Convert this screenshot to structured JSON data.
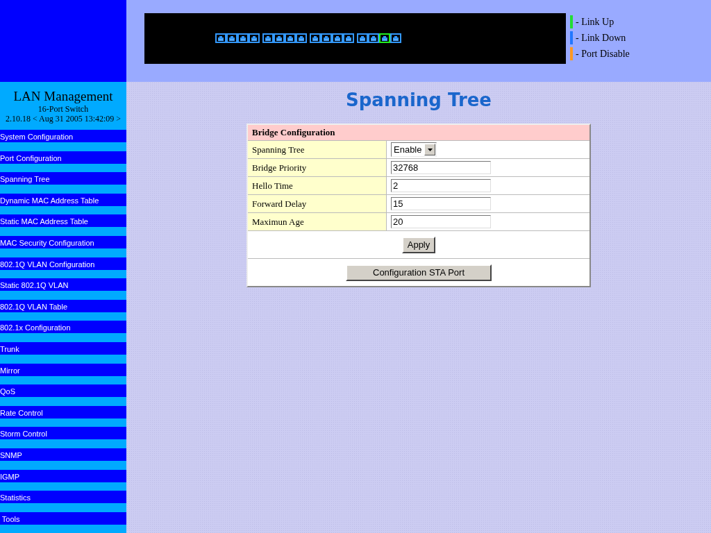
{
  "ports": [
    {
      "link_up": false
    },
    {
      "link_up": false
    },
    {
      "link_up": false
    },
    {
      "link_up": false
    },
    {
      "link_up": false
    },
    {
      "link_up": false
    },
    {
      "link_up": false
    },
    {
      "link_up": false
    },
    {
      "link_up": false
    },
    {
      "link_up": false
    },
    {
      "link_up": false
    },
    {
      "link_up": false
    },
    {
      "link_up": false
    },
    {
      "link_up": false
    },
    {
      "link_up": true
    },
    {
      "link_up": false
    }
  ],
  "legend": [
    {
      "label": "- Link Up",
      "color": "#22dd33"
    },
    {
      "label": "- Link Down",
      "color": "#2277ff"
    },
    {
      "label": "- Port Disable",
      "color": "#ff9922"
    }
  ],
  "brand": {
    "title": "LAN Management",
    "model": "16-Port Switch",
    "version": "2.10.18 < Aug 31 2005 13:42:09 >"
  },
  "sidebar": {
    "items": [
      {
        "label": "System Configuration"
      },
      {
        "label": "Port Configuration"
      },
      {
        "label": "Spanning Tree"
      },
      {
        "label": "Dynamic MAC Address Table"
      },
      {
        "label": "Static MAC Address Table"
      },
      {
        "label": "MAC Security Configuration"
      },
      {
        "label": "802.1Q VLAN Configuration"
      },
      {
        "label": "Static 802.1Q VLAN"
      },
      {
        "label": "802.1Q VLAN Table"
      },
      {
        "label": "802.1x Configuration"
      },
      {
        "label": "Trunk"
      },
      {
        "label": "Mirror"
      },
      {
        "label": "QoS"
      },
      {
        "label": "Rate Control"
      },
      {
        "label": "Storm Control"
      },
      {
        "label": "SNMP"
      },
      {
        "label": "IGMP"
      },
      {
        "label": "Statistics"
      },
      {
        "label": " Tools"
      }
    ]
  },
  "page_title": "Spanning Tree",
  "form": {
    "heading": "Bridge Configuration",
    "rows": [
      {
        "kind": "select",
        "label": "Spanning Tree",
        "value": "Enable"
      },
      {
        "kind": "text",
        "label": "Bridge Priority",
        "value": "32768"
      },
      {
        "kind": "text",
        "label": "Hello Time",
        "value": "2"
      },
      {
        "kind": "text",
        "label": "Forward Delay",
        "value": "15"
      },
      {
        "kind": "text",
        "label": "Maximun Age",
        "value": "20"
      }
    ],
    "apply_button": "Apply",
    "port_button": "Configuration STA Port"
  }
}
